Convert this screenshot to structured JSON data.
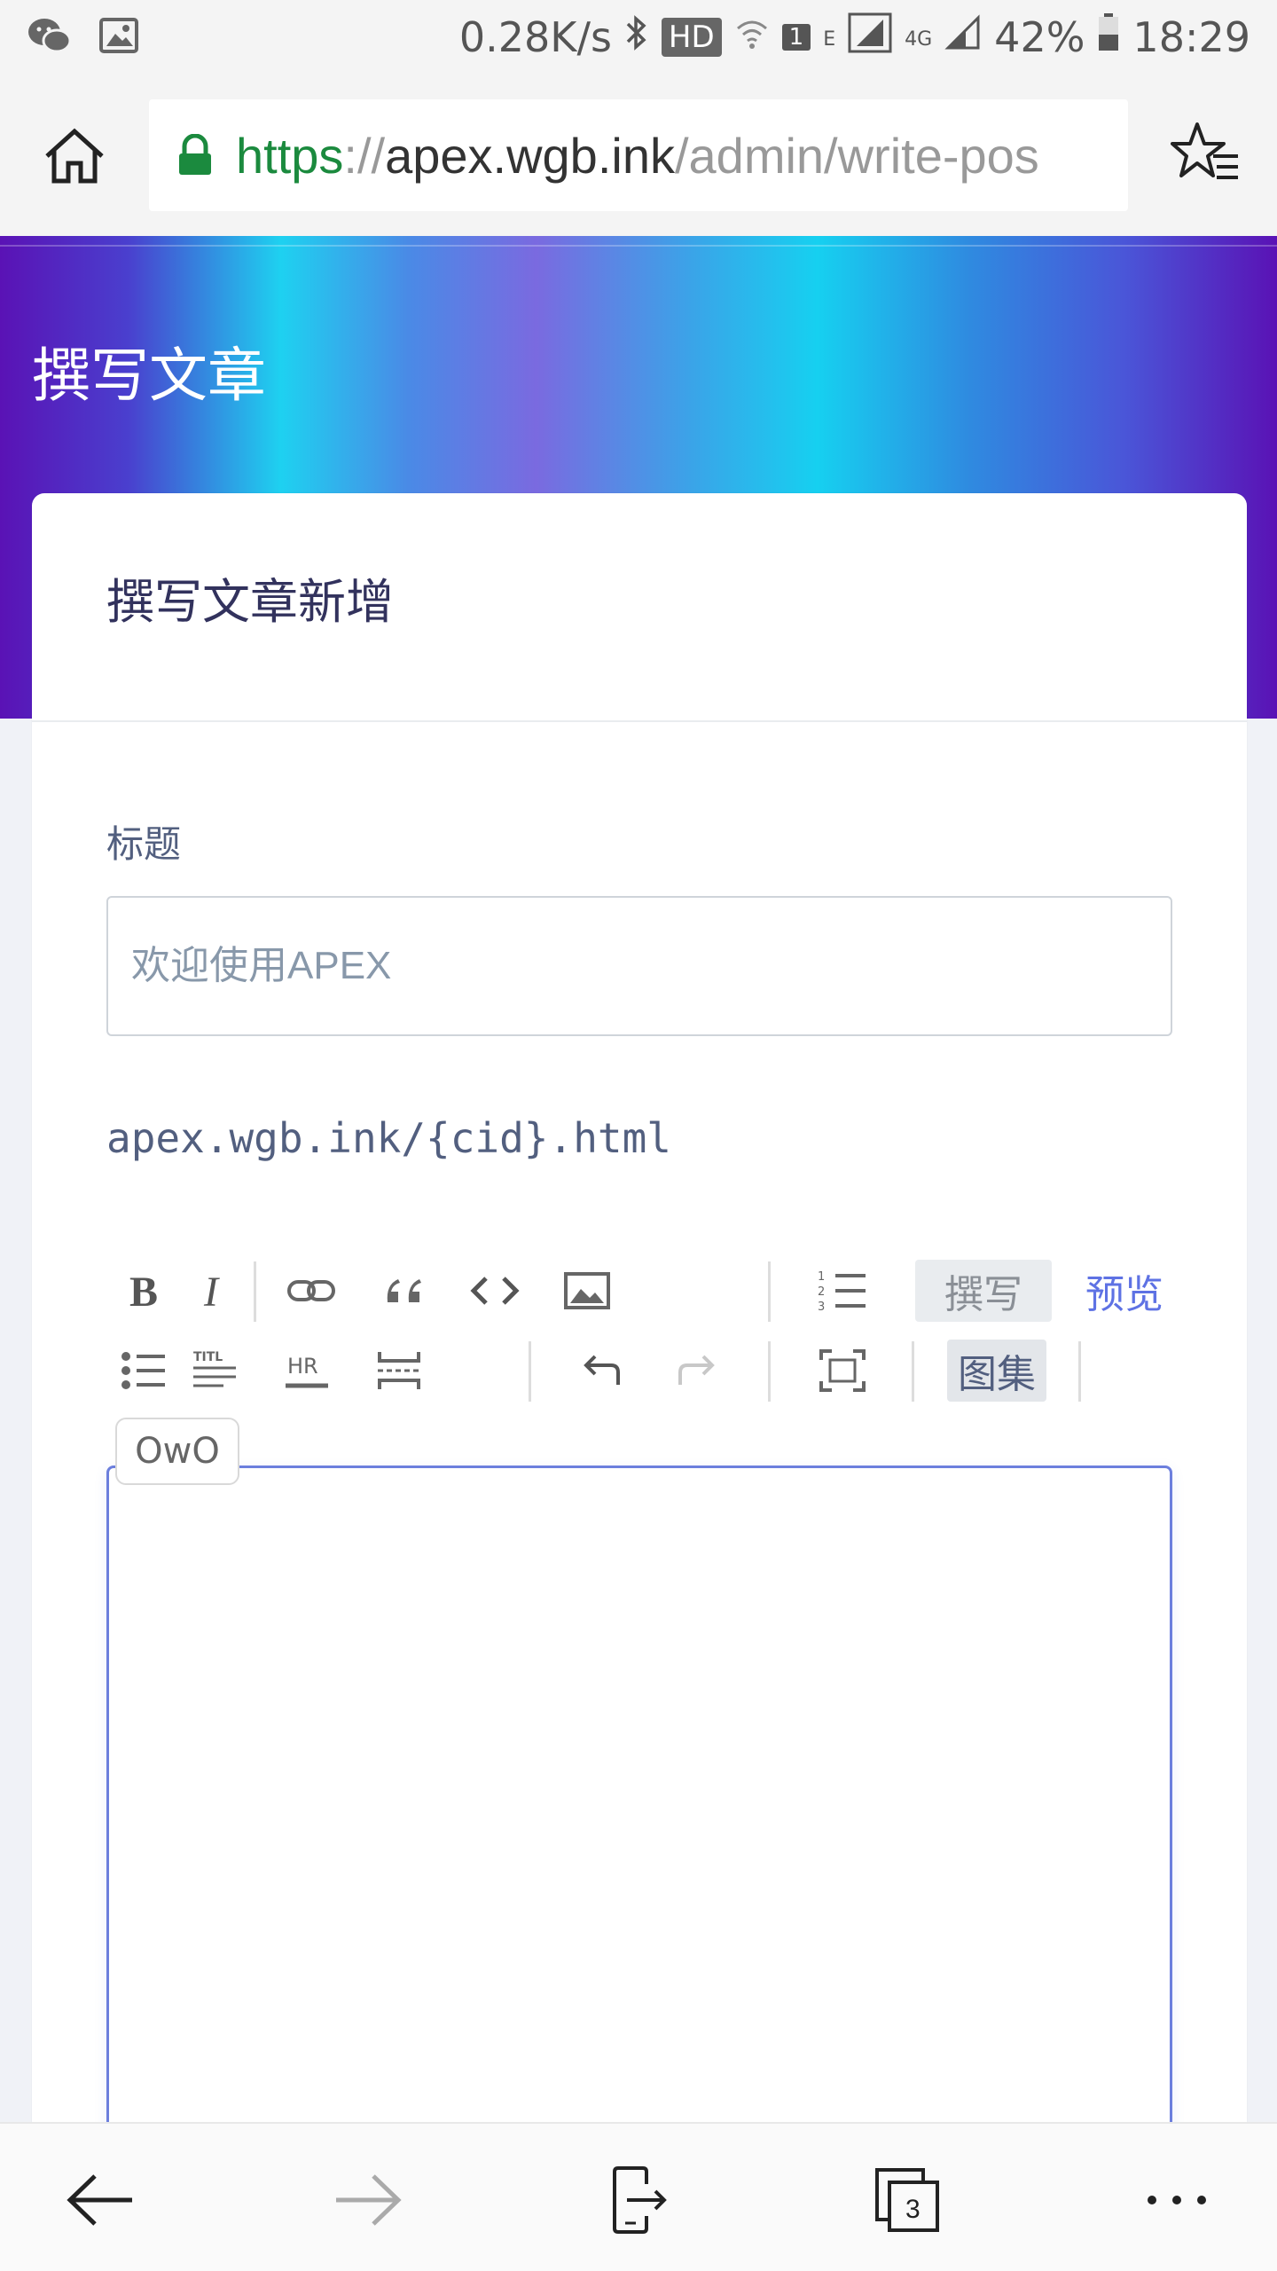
{
  "status_bar": {
    "network_speed": "0.28K/s",
    "hd_badge": "HD",
    "sim_badge": "1",
    "network_type_e": "E",
    "network_type_4g": "4G",
    "battery": "42%",
    "time": "18:29"
  },
  "browser": {
    "url_scheme": "https",
    "url_separator": "://",
    "url_host": "apex.wgb.ink",
    "url_path": "/admin/write-pos",
    "tabs_count": "3"
  },
  "page": {
    "title": "撰写文章",
    "card_title": "撰写文章新增",
    "title_label": "标题",
    "title_placeholder": "欢迎使用APEX",
    "permalink": "apex.wgb.ink/{cid}.html"
  },
  "editor": {
    "tab_write": "撰写",
    "tab_preview": "预览",
    "tab_gallery": "图集",
    "owo_label": "OwO",
    "active_tab": "撰写"
  },
  "colors": {
    "accent": "#5e72e4",
    "url_green": "#1b8a3e",
    "header_purple": "#5a12b5",
    "header_cyan": "#16d0f0"
  },
  "icons": {
    "status_left": [
      "wechat-icon",
      "image-icon"
    ],
    "toolbar_row1": [
      "bold-icon",
      "italic-icon",
      "link-icon",
      "quote-icon",
      "code-icon",
      "image-icon",
      "ordered-list-icon"
    ],
    "toolbar_row2": [
      "unordered-list-icon",
      "title-icon",
      "hr-icon",
      "page-break-icon",
      "undo-icon",
      "redo-icon",
      "fullscreen-icon"
    ],
    "bottom_nav": [
      "back-arrow-icon",
      "forward-arrow-icon",
      "exit-icon",
      "tabs-icon",
      "more-icon"
    ]
  }
}
